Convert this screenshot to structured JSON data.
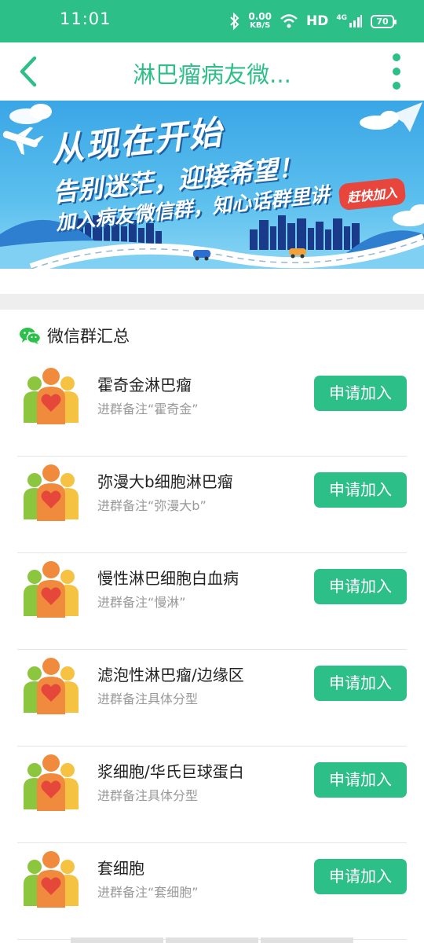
{
  "status_bar": {
    "time": "11:01",
    "net_speed_value": "0.00",
    "net_speed_unit": "KB/S",
    "hd_label": "HD",
    "signal_label": "4G",
    "battery": "70"
  },
  "header": {
    "title": "淋巴瘤病友微...",
    "back_icon": "chevron-left-icon",
    "more_icon": "more-vertical-icon"
  },
  "banner": {
    "line1": "从现在开始",
    "line2": "告别迷茫，迎接希望！",
    "line3": "加入病友微信群，知心话群里讲",
    "badge": "赶快加入"
  },
  "section": {
    "title": "微信群汇总",
    "icon": "wechat-icon"
  },
  "groups": [
    {
      "name": "霍奇金淋巴瘤",
      "note": "进群备注“霍奇金”",
      "button": "申请加入"
    },
    {
      "name": "弥漫大b细胞淋巴瘤",
      "note": "进群备注“弥漫大b”",
      "button": "申请加入"
    },
    {
      "name": "慢性淋巴细胞白血病",
      "note": "进群备注“慢淋”",
      "button": "申请加入"
    },
    {
      "name": "滤泡性淋巴瘤/边缘区",
      "note": "进群备注具体分型",
      "button": "申请加入"
    },
    {
      "name": "浆细胞/华氏巨球蛋白",
      "note": "进群备注具体分型",
      "button": "申请加入"
    },
    {
      "name": "套细胞",
      "note": "进群备注“套细胞”",
      "button": "申请加入"
    }
  ],
  "colors": {
    "brand": "#2dbf88",
    "banner_sky": "#3aa6e6",
    "avatar_heart": "#e5483a"
  }
}
